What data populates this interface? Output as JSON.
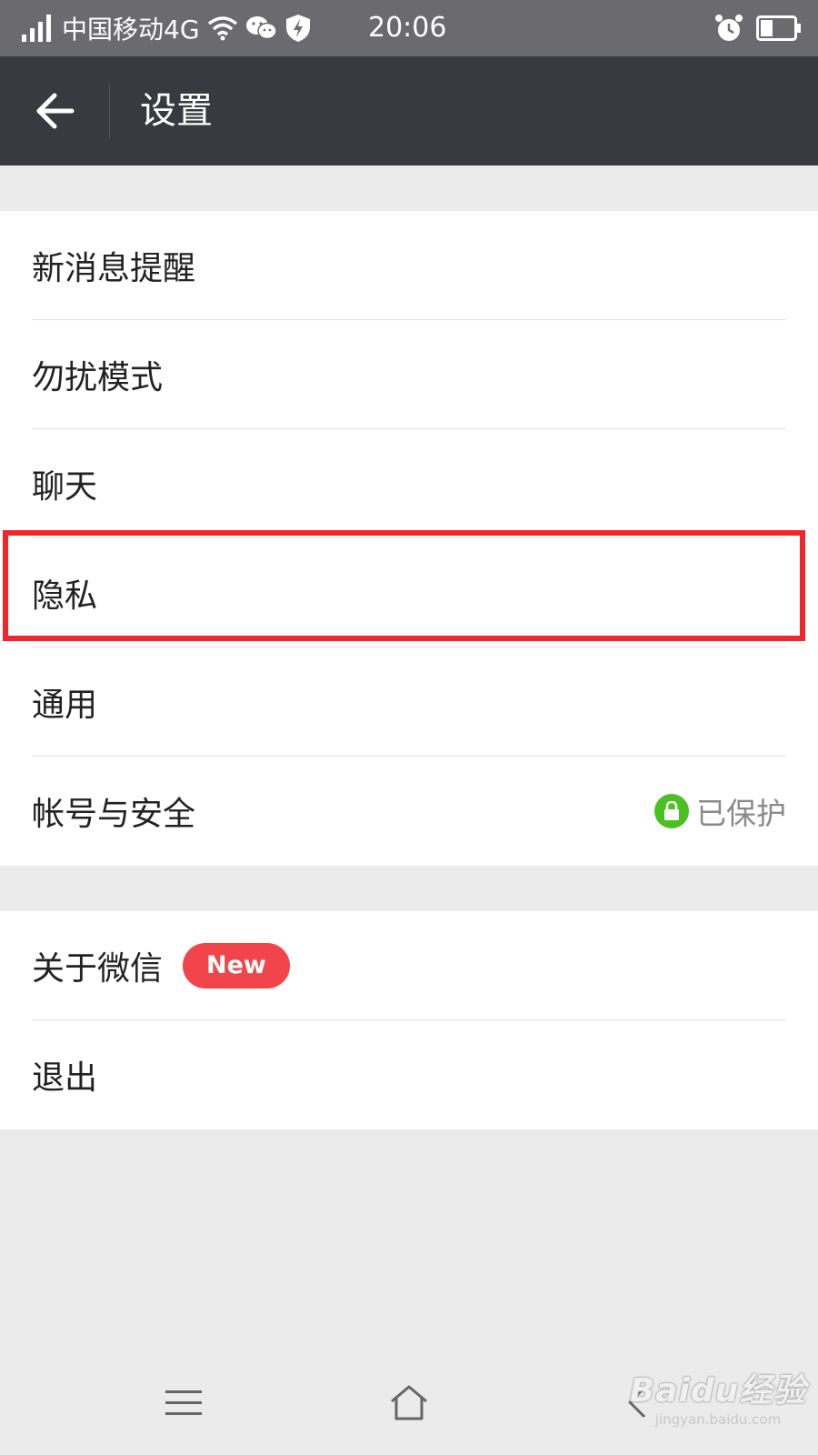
{
  "status_bar": {
    "carrier": "中国移动4G",
    "time": "20:06",
    "icons": [
      "signal-icon",
      "wifi-icon",
      "wechat-icon",
      "shield-icon",
      "alarm-icon",
      "battery-icon"
    ]
  },
  "app_bar": {
    "title": "设置",
    "back_icon": "back-arrow-icon"
  },
  "settings": {
    "group1": [
      {
        "label": "新消息提醒"
      },
      {
        "label": "勿扰模式"
      },
      {
        "label": "聊天"
      },
      {
        "label": "隐私"
      },
      {
        "label": "通用"
      },
      {
        "label": "帐号与安全",
        "status": "已保护"
      }
    ],
    "group2": [
      {
        "label": "关于微信",
        "badge": "New"
      },
      {
        "label": "退出"
      }
    ]
  },
  "nav_bar": {
    "icons": [
      "menu-icon",
      "home-icon",
      "back-icon"
    ]
  },
  "watermark": {
    "main": "Baidu经验",
    "sub": "jingyan.baidu.com"
  },
  "colors": {
    "status_bar": "#6b6a6e",
    "app_bar": "#393a3f",
    "background": "#ebebeb",
    "highlight": "#f0262a",
    "new_badge": "#f1454b",
    "protected": "#49c120"
  }
}
